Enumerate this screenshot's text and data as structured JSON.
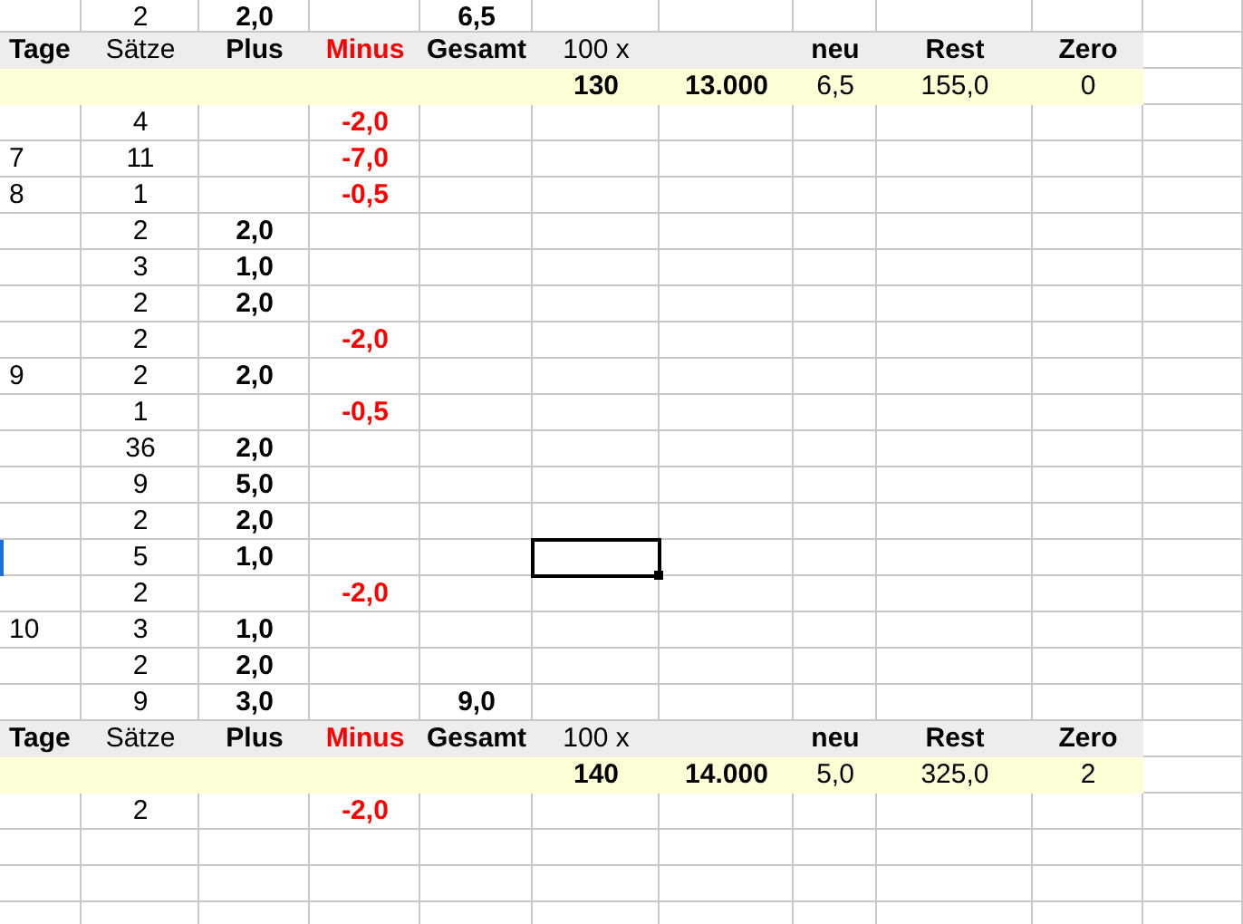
{
  "columns": [
    {
      "selected": false
    },
    {
      "selected": false
    },
    {
      "selected": false
    },
    {
      "selected": false
    },
    {
      "selected": false
    },
    {
      "selected": true
    },
    {
      "selected": false
    },
    {
      "selected": false
    },
    {
      "selected": false
    },
    {
      "selected": false
    },
    {
      "selected": false
    }
  ],
  "rows": [
    {
      "kind": "data",
      "selected": false,
      "cells": {
        "saetze": "2",
        "plus": "2,0",
        "gesamt": "6,5"
      }
    },
    {
      "kind": "header",
      "selected": false,
      "cells": {
        "tage": "Tage",
        "saetze": "Sätze",
        "plus": "Plus",
        "minus": "Minus",
        "gesamt": "Gesamt",
        "col_6": "100 x",
        "neu": "neu",
        "rest": "Rest",
        "zero": "Zero"
      }
    },
    {
      "kind": "summary",
      "selected": false,
      "cells": {
        "col_6": "130",
        "col_7": "13.000",
        "neu": "6,5",
        "rest": "155,0",
        "zero": "0"
      }
    },
    {
      "kind": "data",
      "selected": false,
      "cells": {
        "saetze": "4",
        "minus": "-2,0"
      }
    },
    {
      "kind": "data",
      "selected": false,
      "cells": {
        "tage": "7",
        "saetze": "11",
        "minus": "-7,0"
      }
    },
    {
      "kind": "data",
      "selected": false,
      "cells": {
        "tage": "8",
        "saetze": "1",
        "minus": "-0,5"
      }
    },
    {
      "kind": "data",
      "selected": false,
      "cells": {
        "saetze": "2",
        "plus": "2,0"
      }
    },
    {
      "kind": "data",
      "selected": false,
      "cells": {
        "saetze": "3",
        "plus": "1,0"
      }
    },
    {
      "kind": "data",
      "selected": false,
      "cells": {
        "saetze": "2",
        "plus": "2,0"
      }
    },
    {
      "kind": "data",
      "selected": false,
      "cells": {
        "saetze": "2",
        "minus": "-2,0"
      }
    },
    {
      "kind": "data",
      "selected": false,
      "cells": {
        "tage": "9",
        "saetze": "2",
        "plus": "2,0"
      }
    },
    {
      "kind": "data",
      "selected": false,
      "cells": {
        "saetze": "1",
        "minus": "-0,5"
      }
    },
    {
      "kind": "data",
      "selected": false,
      "cells": {
        "saetze": "36",
        "plus": "2,0"
      }
    },
    {
      "kind": "data",
      "selected": false,
      "cells": {
        "saetze": "9",
        "plus": "5,0"
      }
    },
    {
      "kind": "data",
      "selected": false,
      "cells": {
        "saetze": "2",
        "plus": "2,0"
      }
    },
    {
      "kind": "data",
      "selected": true,
      "cells": {
        "saetze": "5",
        "plus": "1,0"
      }
    },
    {
      "kind": "data",
      "selected": false,
      "cells": {
        "saetze": "2",
        "minus": "-2,0"
      }
    },
    {
      "kind": "data",
      "selected": false,
      "cells": {
        "tage": "10",
        "saetze": "3",
        "plus": "1,0"
      }
    },
    {
      "kind": "data",
      "selected": false,
      "cells": {
        "saetze": "2",
        "plus": "2,0"
      }
    },
    {
      "kind": "data",
      "selected": false,
      "cells": {
        "saetze": "9",
        "plus": "3,0",
        "gesamt": "9,0"
      }
    },
    {
      "kind": "header",
      "selected": false,
      "cells": {
        "tage": "Tage",
        "saetze": "Sätze",
        "plus": "Plus",
        "minus": "Minus",
        "gesamt": "Gesamt",
        "col_6": "100 x",
        "neu": "neu",
        "rest": "Rest",
        "zero": "Zero"
      }
    },
    {
      "kind": "summary",
      "selected": false,
      "cells": {
        "col_6": "140",
        "col_7": "14.000",
        "neu": "5,0",
        "rest": "325,0",
        "zero": "2"
      }
    },
    {
      "kind": "data",
      "selected": false,
      "cells": {
        "saetze": "2",
        "minus": "-2,0"
      }
    }
  ]
}
